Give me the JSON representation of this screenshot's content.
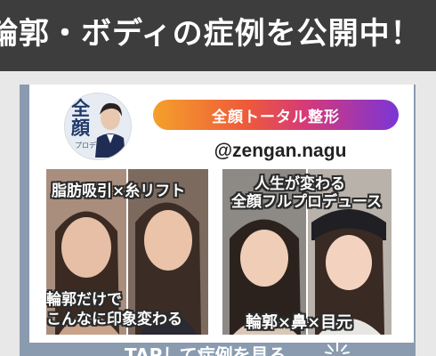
{
  "header": {
    "title": "輪郭・ボディの症例を公開中！"
  },
  "profile": {
    "logo_text": "全顔",
    "logo_subtext": "プロデュース"
  },
  "banner": {
    "pill_label": "全顔トータル整形",
    "handle": "@zengan.nagu"
  },
  "photos": [
    {
      "top_caption": "脂肪吸引×糸リフト",
      "bottom_caption_lines": [
        "輪郭だけで",
        "こんなに印象変わる"
      ]
    },
    {
      "top_caption_lines": [
        "人生が変わる",
        "全顔フルプロデュース"
      ],
      "bottom_caption": "輪郭×鼻×目元"
    }
  ],
  "footer": {
    "cta_text": "TAPして症例を見る"
  },
  "colors": {
    "header_bg": "#3d3d3d",
    "card_frame": "#8a9bb0",
    "pill_gradient_start": "#f4a12a",
    "pill_gradient_end": "#7b35d6"
  }
}
